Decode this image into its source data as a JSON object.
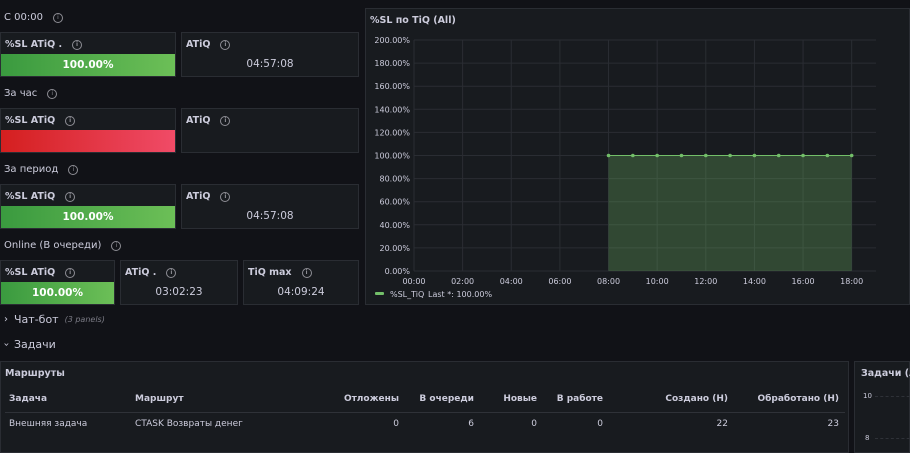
{
  "rows": {
    "row1_title": "С 00:00",
    "row2_title": "За час",
    "row3_title": "За период",
    "row4_title": "Online (В очереди)"
  },
  "panels": {
    "r1_sl_title": "%SL ATiQ .",
    "r1_sl_value": "100.00%",
    "r1_atiq_title": "ATiQ",
    "r1_atiq_value": "04:57:08",
    "r2_sl_title": "%SL ATiQ",
    "r2_sl_value": "",
    "r2_atiq_title": "ATiQ",
    "r3_sl_title": "%SL ATiQ",
    "r3_sl_value": "100.00%",
    "r3_atiq_title": "ATiQ",
    "r3_atiq_value": "04:57:08",
    "r4_sl_title": "%SL ATiQ",
    "r4_sl_value": "100.00%",
    "r4_atiq_title": "ATiQ .",
    "r4_atiq_value": "03:02:23",
    "r4_tiqmax_title": "TiQ max",
    "r4_tiqmax_value": "04:09:24"
  },
  "chart_data": {
    "type": "area",
    "title": "%SL по TiQ (All)",
    "x": [
      "08:00",
      "09:00",
      "10:00",
      "11:00",
      "12:00",
      "13:00",
      "14:00",
      "15:00",
      "16:00",
      "17:00",
      "18:00"
    ],
    "xticks": [
      "00:00",
      "02:00",
      "04:00",
      "06:00",
      "08:00",
      "10:00",
      "12:00",
      "14:00",
      "16:00",
      "18:00"
    ],
    "yticks": [
      "0.00%",
      "20.00%",
      "40.00%",
      "60.00%",
      "80.00%",
      "100.00%",
      "120.00%",
      "140.00%",
      "160.00%",
      "180.00%",
      "200.00%"
    ],
    "ylim": [
      0,
      200
    ],
    "xlim": [
      "00:00",
      "19:00"
    ],
    "series": [
      {
        "name": "%SL_TiQ",
        "values": [
          100,
          100,
          100,
          100,
          100,
          100,
          100,
          100,
          100,
          100,
          100
        ]
      }
    ],
    "legend_label": "%SL_TiQ",
    "legend_stat": "Last *: 100.00%",
    "legend": "bottom-left",
    "grid": true,
    "color": "#73bf69"
  },
  "sections": {
    "chatbot": "Чат-бот",
    "chatbot_hint": "(3 panels)",
    "tasks": "Задачи"
  },
  "routes": {
    "title": "Маршруты",
    "columns": [
      "Задача",
      "Маршрут",
      "Отложены",
      "В очереди",
      "Новые",
      "В работе",
      "Создано (Н)",
      "Обработано (Н)"
    ],
    "rows": [
      [
        "Внешняя задача",
        "СTASK Возвраты денег",
        "0",
        "6",
        "0",
        "0",
        "22",
        "23"
      ]
    ]
  },
  "tasks_panel": {
    "title": "Задачи (All)",
    "ytick_top": "10",
    "ytick_2": "8"
  }
}
